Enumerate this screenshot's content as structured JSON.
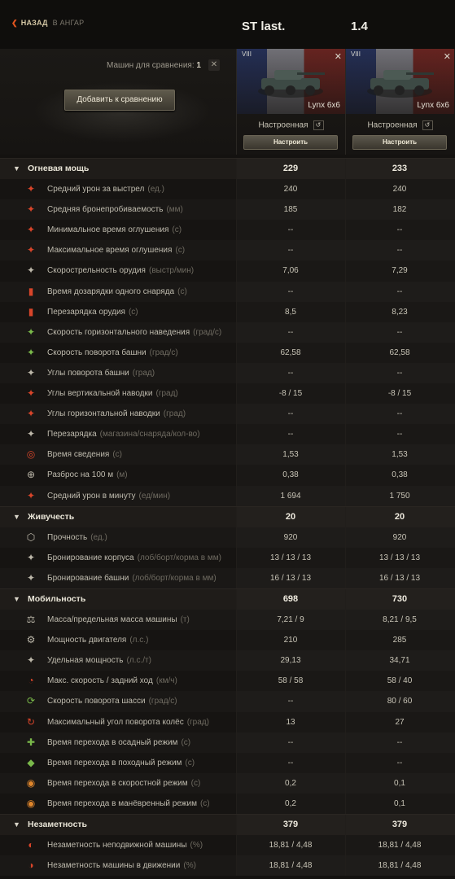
{
  "topbar": {
    "back_label": "НАЗАД",
    "hangar_label": "В АНГАР",
    "title_a": "ST last.",
    "title_b": "1.4"
  },
  "header": {
    "compare_label": "Машин для сравнения:",
    "compare_count": "1",
    "add_button": "Добавить к сравнению"
  },
  "vehicles": [
    {
      "tier": "VIII",
      "name": "Lynx 6x6",
      "state": "Настроенная",
      "configure": "Настроить"
    },
    {
      "tier": "VIII",
      "name": "Lynx 6x6",
      "state": "Настроенная",
      "configure": "Настроить"
    }
  ],
  "sections": [
    {
      "label": "Огневая мощь",
      "v1": "229",
      "v2": "233",
      "rows": [
        {
          "icon": "damage-icon",
          "label": "Средний урон за выстрел",
          "unit": "(ед.)",
          "v1": "240",
          "v2": "240"
        },
        {
          "icon": "penetration-icon",
          "label": "Средняя бронепробиваемость",
          "unit": "(мм)",
          "v1": "185",
          "v2": "182"
        },
        {
          "icon": "stun-min-icon",
          "label": "Минимальное время оглушения",
          "unit": "(с)",
          "v1": "--",
          "v2": "--"
        },
        {
          "icon": "stun-max-icon",
          "label": "Максимальное время оглушения",
          "unit": "(с)",
          "v1": "--",
          "v2": "--"
        },
        {
          "icon": "rate-of-fire-icon",
          "label": "Скорострельность орудия",
          "unit": "(выстр/мин)",
          "v1": "7,06",
          "v2": "7,29"
        },
        {
          "icon": "shell-reload-icon",
          "label": "Время дозарядки одного снаряда",
          "unit": "(с)",
          "v1": "--",
          "v2": "--"
        },
        {
          "icon": "reload-icon",
          "label": "Перезарядка орудия",
          "unit": "(с)",
          "v1": "8,5",
          "v2": "8,23"
        },
        {
          "icon": "gun-traverse-icon",
          "label": "Скорость горизонтального наведения",
          "unit": "(град/с)",
          "v1": "--",
          "v2": "--"
        },
        {
          "icon": "turret-traverse-icon",
          "label": "Скорость поворота башни",
          "unit": "(град/с)",
          "v1": "62,58",
          "v2": "62,58"
        },
        {
          "icon": "turret-angles-icon",
          "label": "Углы поворота башни",
          "unit": "(град)",
          "v1": "--",
          "v2": "--"
        },
        {
          "icon": "elevation-icon",
          "label": "Углы вертикальной наводки",
          "unit": "(град)",
          "v1": "-8 / 15",
          "v2": "-8 / 15"
        },
        {
          "icon": "horizontal-angles-icon",
          "label": "Углы горизонтальной наводки",
          "unit": "(град)",
          "v1": "--",
          "v2": "--"
        },
        {
          "icon": "magazine-icon",
          "label": "Перезарядка",
          "unit": "(магазина/снаряда/кол-во)",
          "v1": "--",
          "v2": "--"
        },
        {
          "icon": "aim-time-icon",
          "label": "Время сведения",
          "unit": "(с)",
          "v1": "1,53",
          "v2": "1,53"
        },
        {
          "icon": "dispersion-icon",
          "label": "Разброс на 100 м",
          "unit": "(м)",
          "v1": "0,38",
          "v2": "0,38"
        },
        {
          "icon": "dpm-icon",
          "label": "Средний урон в минуту",
          "unit": "(ед/мин)",
          "v1": "1 694",
          "v2": "1 750"
        }
      ]
    },
    {
      "label": "Живучесть",
      "v1": "20",
      "v2": "20",
      "rows": [
        {
          "icon": "hitpoints-icon",
          "label": "Прочность",
          "unit": "(ед.)",
          "v1": "920",
          "v2": "920"
        },
        {
          "icon": "hull-armor-icon",
          "label": "Бронирование корпуса",
          "unit": "(лоб/борт/корма в мм)",
          "v1": "13 / 13 / 13",
          "v2": "13 / 13 / 13"
        },
        {
          "icon": "turret-armor-icon",
          "label": "Бронирование башни",
          "unit": "(лоб/борт/корма в мм)",
          "v1": "16 / 13 / 13",
          "v2": "16 / 13 / 13"
        }
      ]
    },
    {
      "label": "Мобильность",
      "v1": "698",
      "v2": "730",
      "rows": [
        {
          "icon": "weight-icon",
          "label": "Масса/предельная масса машины",
          "unit": "(т)",
          "v1": "7,21 / 9",
          "v2": "8,21 / 9,5"
        },
        {
          "icon": "engine-icon",
          "label": "Мощность двигателя",
          "unit": "(л.с.)",
          "v1": "210",
          "v2": "285"
        },
        {
          "icon": "specific-power-icon",
          "label": "Удельная мощность",
          "unit": "(л.с./т)",
          "v1": "29,13",
          "v2": "34,71"
        },
        {
          "icon": "speed-icon",
          "label": "Макс. скорость / задний ход",
          "unit": "(км/ч)",
          "v1": "58 / 58",
          "v2": "58 / 40"
        },
        {
          "icon": "chassis-traverse-icon",
          "label": "Скорость поворота шасси",
          "unit": "(град/с)",
          "v1": "--",
          "v2": "80 / 60"
        },
        {
          "icon": "wheel-angle-icon",
          "label": "Максимальный угол поворота колёс",
          "unit": "(град)",
          "v1": "13",
          "v2": "27"
        },
        {
          "icon": "siege-mode-icon",
          "label": "Время перехода в осадный режим",
          "unit": "(с)",
          "v1": "--",
          "v2": "--"
        },
        {
          "icon": "travel-mode-icon",
          "label": "Время перехода в походный режим",
          "unit": "(с)",
          "v1": "--",
          "v2": "--"
        },
        {
          "icon": "speed-mode-icon",
          "label": "Время перехода в скоростной режим",
          "unit": "(с)",
          "v1": "0,2",
          "v2": "0,1"
        },
        {
          "icon": "maneuver-mode-icon",
          "label": "Время перехода в манёвренный режим",
          "unit": "(с)",
          "v1": "0,2",
          "v2": "0,1"
        }
      ]
    },
    {
      "label": "Незаметность",
      "v1": "379",
      "v2": "379",
      "rows": [
        {
          "icon": "camo-stationary-icon",
          "label": "Незаметность неподвижной машины",
          "unit": "(%)",
          "v1": "18,81 / 4,48",
          "v2": "18,81 / 4,48"
        },
        {
          "icon": "camo-moving-icon",
          "label": "Незаметность машины в движении",
          "unit": "(%)",
          "v1": "18,81 / 4,48",
          "v2": "18,81 / 4,48"
        }
      ]
    }
  ],
  "colors": {
    "accent": "#e2541e",
    "icon_red": "#d8452a",
    "icon_green": "#6cbf3a",
    "text": "#c8c4b6"
  }
}
